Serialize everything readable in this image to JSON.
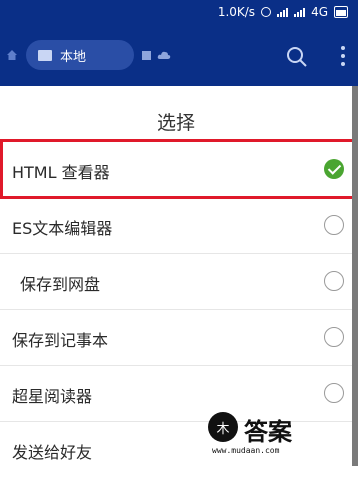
{
  "status_bar": {
    "speed": "1.0K/s",
    "network": "4G"
  },
  "toolbar": {
    "location_label": "本地"
  },
  "dialog": {
    "title": "选择",
    "options": [
      {
        "label": "HTML 查看器",
        "selected": true
      },
      {
        "label": "ES文本编辑器",
        "selected": false
      },
      {
        "label": "保存到网盘",
        "selected": false
      },
      {
        "label": "保存到记事本",
        "selected": false
      },
      {
        "label": "超星阅读器",
        "selected": false
      },
      {
        "label": "发送给好友",
        "selected": false
      }
    ]
  },
  "watermark": {
    "badge": "木",
    "brand": "答案",
    "url": "www.mudaan.com"
  },
  "colors": {
    "header": "#0a2f87",
    "check": "#4aa531",
    "highlight": "#e0192a"
  }
}
